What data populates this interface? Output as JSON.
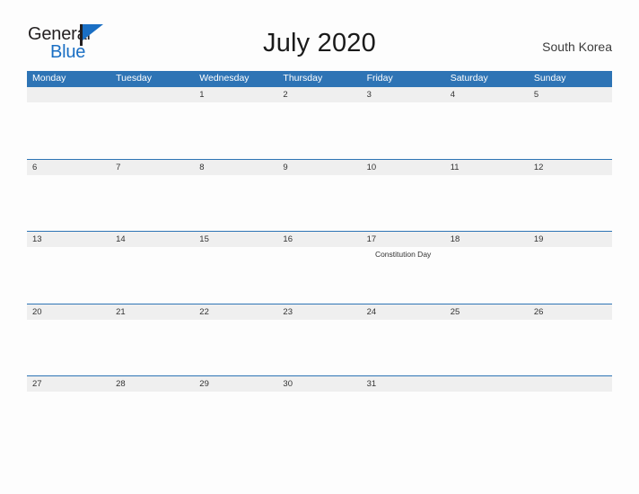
{
  "brand": {
    "name_top": "General",
    "name_bottom": "Blue",
    "flag_icon": "flag-icon",
    "colors": {
      "blue": "#1a6fc4",
      "dark": "#231f20"
    }
  },
  "header": {
    "title": "July 2020",
    "region": "South Korea"
  },
  "theme": {
    "header_blue": "#2e74b5",
    "date_strip_gray": "#efefef",
    "page_background": "#fdfdfd",
    "text_dark": "#333333"
  },
  "calendar": {
    "weekdays": [
      "Monday",
      "Tuesday",
      "Wednesday",
      "Thursday",
      "Friday",
      "Saturday",
      "Sunday"
    ],
    "weeks": [
      {
        "days": [
          {
            "num": "",
            "event": ""
          },
          {
            "num": "",
            "event": ""
          },
          {
            "num": "1",
            "event": ""
          },
          {
            "num": "2",
            "event": ""
          },
          {
            "num": "3",
            "event": ""
          },
          {
            "num": "4",
            "event": ""
          },
          {
            "num": "5",
            "event": ""
          }
        ]
      },
      {
        "days": [
          {
            "num": "6",
            "event": ""
          },
          {
            "num": "7",
            "event": ""
          },
          {
            "num": "8",
            "event": ""
          },
          {
            "num": "9",
            "event": ""
          },
          {
            "num": "10",
            "event": ""
          },
          {
            "num": "11",
            "event": ""
          },
          {
            "num": "12",
            "event": ""
          }
        ]
      },
      {
        "days": [
          {
            "num": "13",
            "event": ""
          },
          {
            "num": "14",
            "event": ""
          },
          {
            "num": "15",
            "event": ""
          },
          {
            "num": "16",
            "event": ""
          },
          {
            "num": "17",
            "event": "Constitution Day"
          },
          {
            "num": "18",
            "event": ""
          },
          {
            "num": "19",
            "event": ""
          }
        ]
      },
      {
        "days": [
          {
            "num": "20",
            "event": ""
          },
          {
            "num": "21",
            "event": ""
          },
          {
            "num": "22",
            "event": ""
          },
          {
            "num": "23",
            "event": ""
          },
          {
            "num": "24",
            "event": ""
          },
          {
            "num": "25",
            "event": ""
          },
          {
            "num": "26",
            "event": ""
          }
        ]
      },
      {
        "days": [
          {
            "num": "27",
            "event": ""
          },
          {
            "num": "28",
            "event": ""
          },
          {
            "num": "29",
            "event": ""
          },
          {
            "num": "30",
            "event": ""
          },
          {
            "num": "31",
            "event": ""
          },
          {
            "num": "",
            "event": ""
          },
          {
            "num": "",
            "event": ""
          }
        ]
      }
    ]
  }
}
